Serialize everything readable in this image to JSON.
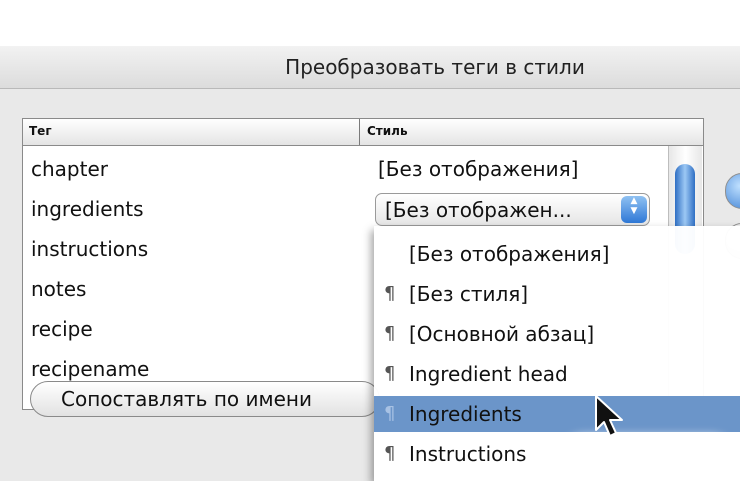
{
  "dialog": {
    "title": "Преобразовать теги в стили"
  },
  "table": {
    "headers": {
      "tag": "Тег",
      "style": "Стиль"
    },
    "rows": [
      {
        "tag": "chapter",
        "style": "[Без отображения]"
      },
      {
        "tag": "ingredients",
        "style": "[Без отображен..."
      },
      {
        "tag": "instructions",
        "style": ""
      },
      {
        "tag": "notes",
        "style": ""
      },
      {
        "tag": "recipe",
        "style": ""
      },
      {
        "tag": "recipename",
        "style": ""
      }
    ]
  },
  "buttons": {
    "match_by_name": "Сопоставлять по имени"
  },
  "menu": {
    "items": [
      {
        "label": "[Без отображения]",
        "paragraph_icon": false,
        "selected": false
      },
      {
        "label": "[Без стиля]",
        "paragraph_icon": true,
        "selected": false
      },
      {
        "label": "[Основной абзац]",
        "paragraph_icon": true,
        "selected": false
      },
      {
        "label": "Ingredient head",
        "paragraph_icon": true,
        "selected": false
      },
      {
        "label": "Ingredients",
        "paragraph_icon": true,
        "selected": true
      },
      {
        "label": "Instructions",
        "paragraph_icon": true,
        "selected": false
      }
    ],
    "paragraph_glyph": "¶"
  },
  "colors": {
    "selection": "#6b95c9",
    "accent_blue": "#2f78d6"
  },
  "icons": {
    "popup_arrows": "up-down-arrows-icon",
    "paragraph": "paragraph-icon",
    "cursor": "mouse-pointer-icon"
  }
}
